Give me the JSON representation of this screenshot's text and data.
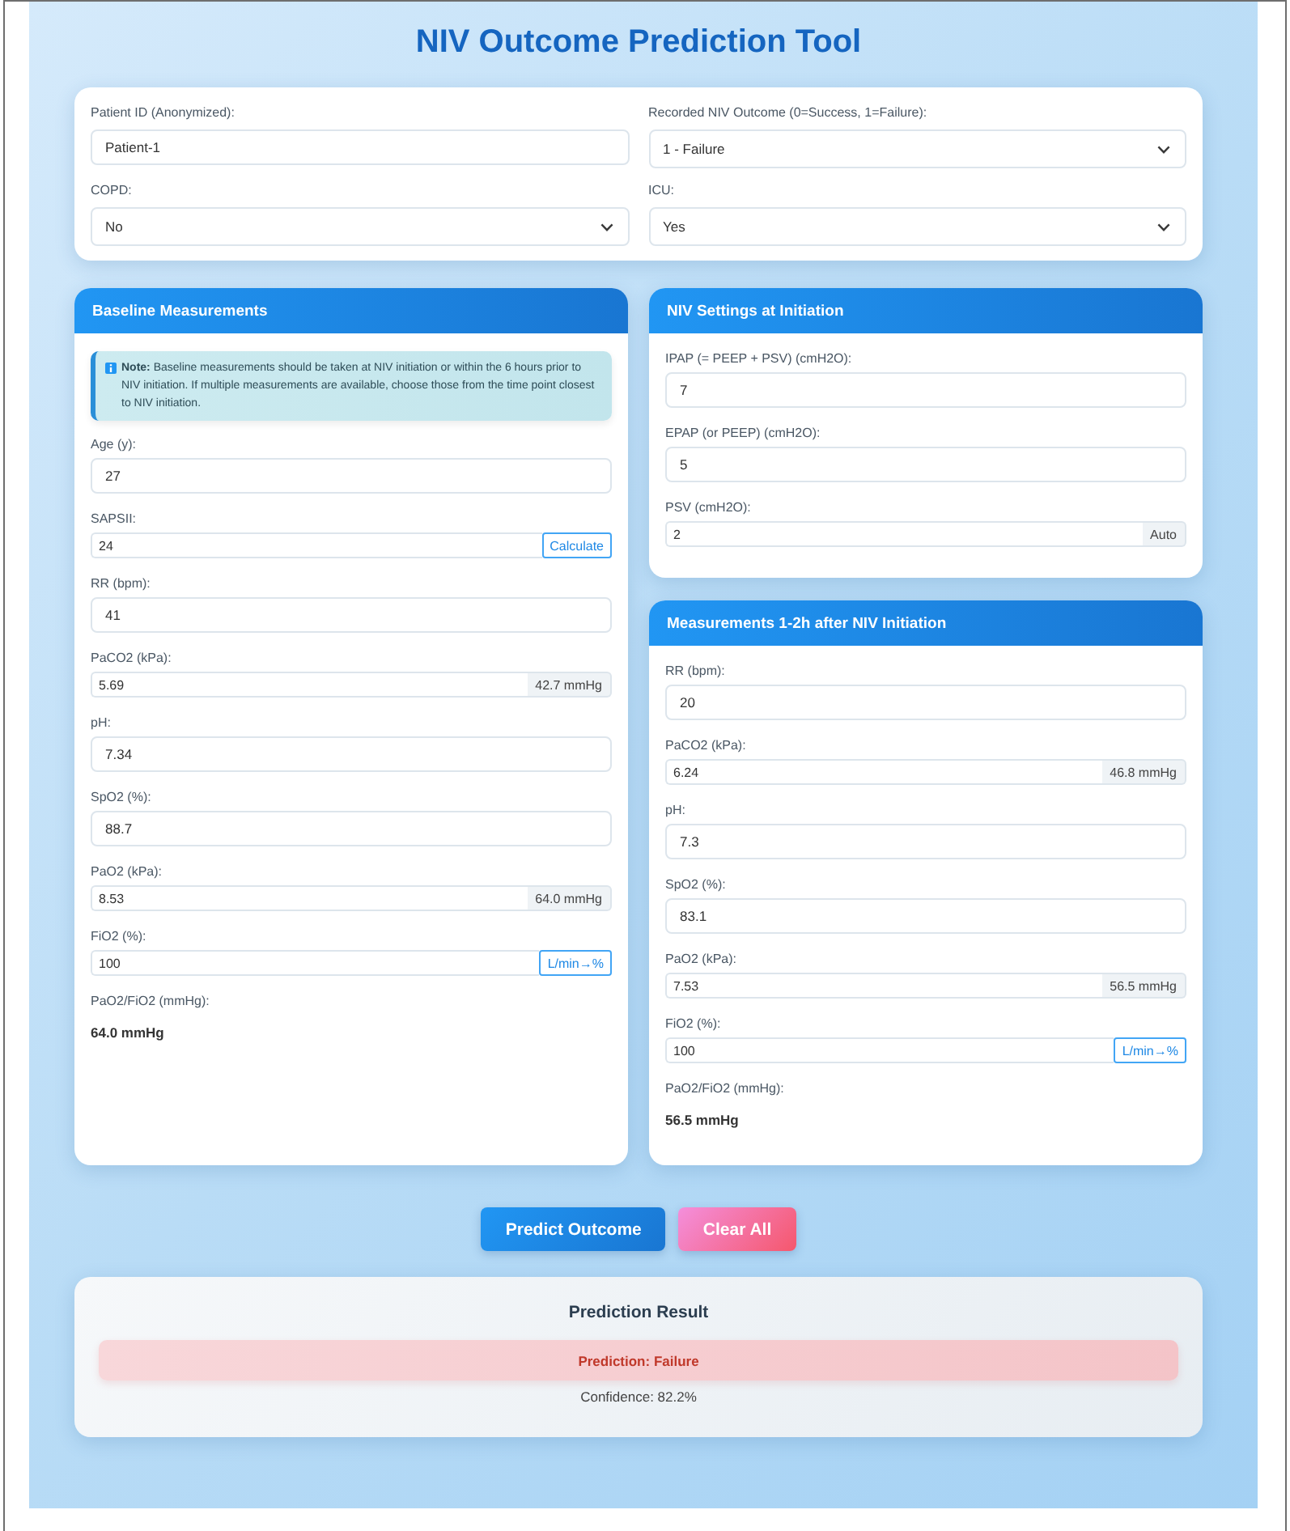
{
  "title": "NIV Outcome Prediction Tool",
  "patient_card": {
    "fields": [
      {
        "label": "Patient ID (Anonymized):",
        "kind": "input",
        "value": "Patient-1"
      },
      {
        "label": "Recorded NIV Outcome (0=Success, 1=Failure):",
        "kind": "select",
        "value": "1 - Failure"
      },
      {
        "label": "COPD:",
        "kind": "select",
        "value": "No"
      },
      {
        "label": "ICU:",
        "kind": "select",
        "value": "Yes"
      }
    ]
  },
  "panels": [
    {
      "title": "Baseline Measurements",
      "note": "**Note:** Baseline measurements should be taken at NIV initiation or within the 6 hours prior to NIV initiation. If multiple measurements are available, choose those from the time point closest to NIV initiation.",
      "fields": [
        {
          "label": "Age (y):",
          "kind": "input",
          "value": "27"
        },
        {
          "label": "SAPSII:",
          "kind": "button",
          "value": "24",
          "addon": "Calculate"
        },
        {
          "label": "RR (bpm):",
          "kind": "input",
          "value": "41"
        },
        {
          "label": "PaCO2 (kPa):",
          "kind": "unit",
          "value": "5.69",
          "addon": "42.7 mmHg"
        },
        {
          "label": "pH:",
          "kind": "input",
          "value": "7.34"
        },
        {
          "label": "SpO2 (%):",
          "kind": "input",
          "value": "88.7"
        },
        {
          "label": "PaO2 (kPa):",
          "kind": "unit",
          "value": "8.53",
          "addon": "64.0 mmHg"
        },
        {
          "label": "FiO2 (%):",
          "kind": "button",
          "value": "100",
          "addon": "L/min→%"
        },
        {
          "label": "PaO2/FiO2 (mmHg):",
          "kind": "computed",
          "value": "64.0 mmHg"
        }
      ]
    },
    {
      "title": "NIV Settings at Initiation",
      "fields": [
        {
          "label": "IPAP (= PEEP + PSV) (cmH2O):",
          "kind": "input",
          "value": "7"
        },
        {
          "label": "EPAP (or PEEP) (cmH2O):",
          "kind": "input",
          "value": "5"
        },
        {
          "label": "PSV (cmH2O):",
          "kind": "unit",
          "value": "2",
          "addon": "Auto"
        }
      ]
    },
    {
      "title": "Measurements 1-2h after NIV Initiation",
      "fields": [
        {
          "label": "RR (bpm):",
          "kind": "input",
          "value": "20"
        },
        {
          "label": "PaCO2 (kPa):",
          "kind": "unit",
          "value": "6.24",
          "addon": "46.8 mmHg"
        },
        {
          "label": "pH:",
          "kind": "input",
          "value": "7.3"
        },
        {
          "label": "SpO2 (%):",
          "kind": "input",
          "value": "83.1"
        },
        {
          "label": "PaO2 (kPa):",
          "kind": "unit",
          "value": "7.53",
          "addon": "56.5 mmHg"
        },
        {
          "label": "FiO2 (%):",
          "kind": "button",
          "value": "100",
          "addon": "L/min→%"
        },
        {
          "label": "PaO2/FiO2 (mmHg):",
          "kind": "computed",
          "value": "56.5 mmHg"
        }
      ]
    }
  ],
  "actions": [
    {
      "label": "Predict Outcome",
      "kind": "primary"
    },
    {
      "label": "Clear All",
      "kind": "danger"
    }
  ],
  "result": {
    "title": "Prediction Result",
    "prediction": "Prediction: Failure",
    "kind": "failure",
    "confidence": "Confidence: 82.2%"
  }
}
